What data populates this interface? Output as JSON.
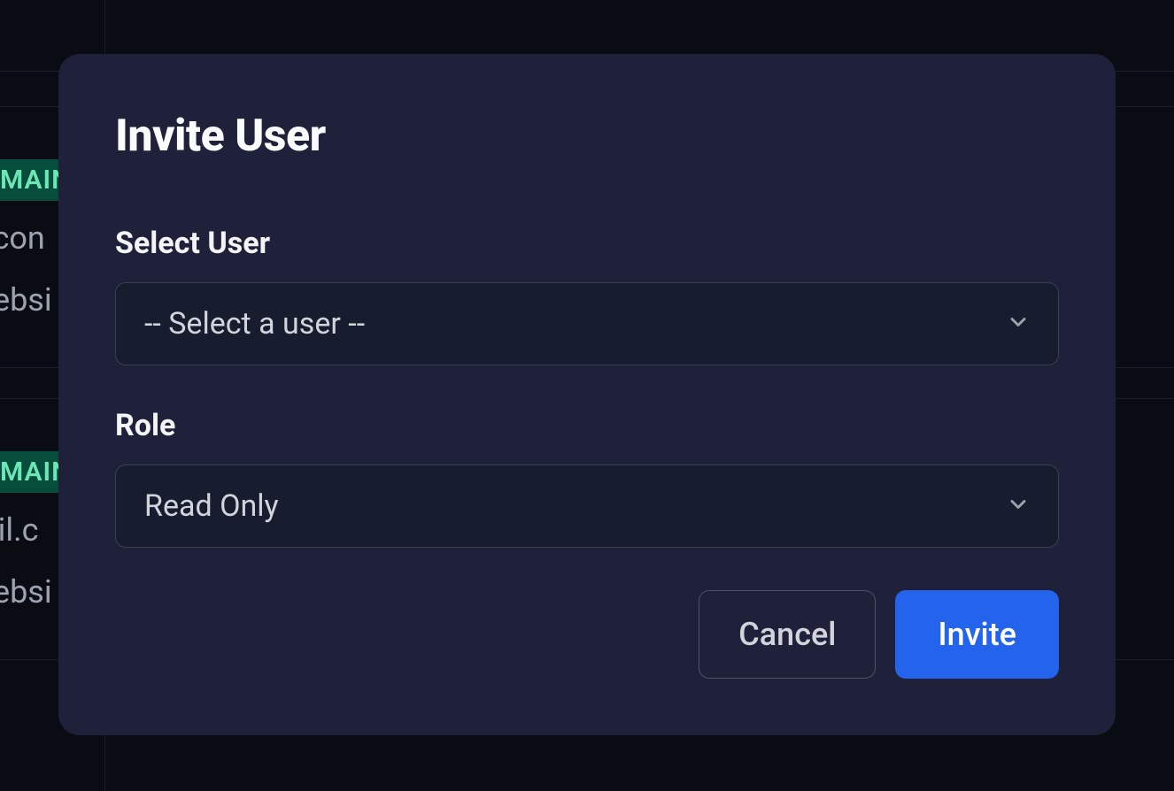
{
  "background": {
    "badge_text": "MAINT",
    "row1_text": ".con",
    "row2_text": "ebsi",
    "row3_text": "ail.c",
    "row4_text": "ebsi"
  },
  "modal": {
    "title": "Invite User",
    "user_field": {
      "label": "Select User",
      "placeholder": "-- Select a user --"
    },
    "role_field": {
      "label": "Role",
      "value": "Read Only"
    },
    "buttons": {
      "cancel": "Cancel",
      "invite": "Invite"
    }
  }
}
